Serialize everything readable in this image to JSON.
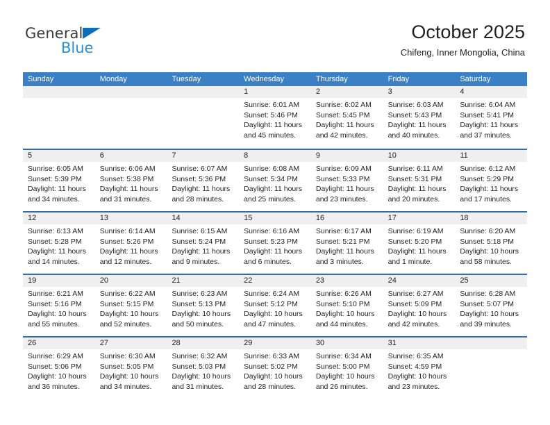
{
  "brand": {
    "name_top": "General",
    "name_bottom": "Blue",
    "triangle_color": "#0e6dbb",
    "blue_color": "#2b8fd8"
  },
  "header": {
    "month_title": "October 2025",
    "location": "Chifeng, Inner Mongolia, China"
  },
  "theme": {
    "header_bg": "#3b7fc4",
    "row_divider": "#2e6da8",
    "day_band_bg": "#efefef"
  },
  "calendar": {
    "weekdays": [
      "Sunday",
      "Monday",
      "Tuesday",
      "Wednesday",
      "Thursday",
      "Friday",
      "Saturday"
    ],
    "weeks": [
      [
        {
          "day": "",
          "lines": []
        },
        {
          "day": "",
          "lines": []
        },
        {
          "day": "",
          "lines": []
        },
        {
          "day": "1",
          "lines": [
            "Sunrise: 6:01 AM",
            "Sunset: 5:46 PM",
            "Daylight: 11 hours",
            "and 45 minutes."
          ]
        },
        {
          "day": "2",
          "lines": [
            "Sunrise: 6:02 AM",
            "Sunset: 5:45 PM",
            "Daylight: 11 hours",
            "and 42 minutes."
          ]
        },
        {
          "day": "3",
          "lines": [
            "Sunrise: 6:03 AM",
            "Sunset: 5:43 PM",
            "Daylight: 11 hours",
            "and 40 minutes."
          ]
        },
        {
          "day": "4",
          "lines": [
            "Sunrise: 6:04 AM",
            "Sunset: 5:41 PM",
            "Daylight: 11 hours",
            "and 37 minutes."
          ]
        }
      ],
      [
        {
          "day": "5",
          "lines": [
            "Sunrise: 6:05 AM",
            "Sunset: 5:39 PM",
            "Daylight: 11 hours",
            "and 34 minutes."
          ]
        },
        {
          "day": "6",
          "lines": [
            "Sunrise: 6:06 AM",
            "Sunset: 5:38 PM",
            "Daylight: 11 hours",
            "and 31 minutes."
          ]
        },
        {
          "day": "7",
          "lines": [
            "Sunrise: 6:07 AM",
            "Sunset: 5:36 PM",
            "Daylight: 11 hours",
            "and 28 minutes."
          ]
        },
        {
          "day": "8",
          "lines": [
            "Sunrise: 6:08 AM",
            "Sunset: 5:34 PM",
            "Daylight: 11 hours",
            "and 25 minutes."
          ]
        },
        {
          "day": "9",
          "lines": [
            "Sunrise: 6:09 AM",
            "Sunset: 5:33 PM",
            "Daylight: 11 hours",
            "and 23 minutes."
          ]
        },
        {
          "day": "10",
          "lines": [
            "Sunrise: 6:11 AM",
            "Sunset: 5:31 PM",
            "Daylight: 11 hours",
            "and 20 minutes."
          ]
        },
        {
          "day": "11",
          "lines": [
            "Sunrise: 6:12 AM",
            "Sunset: 5:29 PM",
            "Daylight: 11 hours",
            "and 17 minutes."
          ]
        }
      ],
      [
        {
          "day": "12",
          "lines": [
            "Sunrise: 6:13 AM",
            "Sunset: 5:28 PM",
            "Daylight: 11 hours",
            "and 14 minutes."
          ]
        },
        {
          "day": "13",
          "lines": [
            "Sunrise: 6:14 AM",
            "Sunset: 5:26 PM",
            "Daylight: 11 hours",
            "and 12 minutes."
          ]
        },
        {
          "day": "14",
          "lines": [
            "Sunrise: 6:15 AM",
            "Sunset: 5:24 PM",
            "Daylight: 11 hours",
            "and 9 minutes."
          ]
        },
        {
          "day": "15",
          "lines": [
            "Sunrise: 6:16 AM",
            "Sunset: 5:23 PM",
            "Daylight: 11 hours",
            "and 6 minutes."
          ]
        },
        {
          "day": "16",
          "lines": [
            "Sunrise: 6:17 AM",
            "Sunset: 5:21 PM",
            "Daylight: 11 hours",
            "and 3 minutes."
          ]
        },
        {
          "day": "17",
          "lines": [
            "Sunrise: 6:19 AM",
            "Sunset: 5:20 PM",
            "Daylight: 11 hours",
            "and 1 minute."
          ]
        },
        {
          "day": "18",
          "lines": [
            "Sunrise: 6:20 AM",
            "Sunset: 5:18 PM",
            "Daylight: 10 hours",
            "and 58 minutes."
          ]
        }
      ],
      [
        {
          "day": "19",
          "lines": [
            "Sunrise: 6:21 AM",
            "Sunset: 5:16 PM",
            "Daylight: 10 hours",
            "and 55 minutes."
          ]
        },
        {
          "day": "20",
          "lines": [
            "Sunrise: 6:22 AM",
            "Sunset: 5:15 PM",
            "Daylight: 10 hours",
            "and 52 minutes."
          ]
        },
        {
          "day": "21",
          "lines": [
            "Sunrise: 6:23 AM",
            "Sunset: 5:13 PM",
            "Daylight: 10 hours",
            "and 50 minutes."
          ]
        },
        {
          "day": "22",
          "lines": [
            "Sunrise: 6:24 AM",
            "Sunset: 5:12 PM",
            "Daylight: 10 hours",
            "and 47 minutes."
          ]
        },
        {
          "day": "23",
          "lines": [
            "Sunrise: 6:26 AM",
            "Sunset: 5:10 PM",
            "Daylight: 10 hours",
            "and 44 minutes."
          ]
        },
        {
          "day": "24",
          "lines": [
            "Sunrise: 6:27 AM",
            "Sunset: 5:09 PM",
            "Daylight: 10 hours",
            "and 42 minutes."
          ]
        },
        {
          "day": "25",
          "lines": [
            "Sunrise: 6:28 AM",
            "Sunset: 5:07 PM",
            "Daylight: 10 hours",
            "and 39 minutes."
          ]
        }
      ],
      [
        {
          "day": "26",
          "lines": [
            "Sunrise: 6:29 AM",
            "Sunset: 5:06 PM",
            "Daylight: 10 hours",
            "and 36 minutes."
          ]
        },
        {
          "day": "27",
          "lines": [
            "Sunrise: 6:30 AM",
            "Sunset: 5:05 PM",
            "Daylight: 10 hours",
            "and 34 minutes."
          ]
        },
        {
          "day": "28",
          "lines": [
            "Sunrise: 6:32 AM",
            "Sunset: 5:03 PM",
            "Daylight: 10 hours",
            "and 31 minutes."
          ]
        },
        {
          "day": "29",
          "lines": [
            "Sunrise: 6:33 AM",
            "Sunset: 5:02 PM",
            "Daylight: 10 hours",
            "and 28 minutes."
          ]
        },
        {
          "day": "30",
          "lines": [
            "Sunrise: 6:34 AM",
            "Sunset: 5:00 PM",
            "Daylight: 10 hours",
            "and 26 minutes."
          ]
        },
        {
          "day": "31",
          "lines": [
            "Sunrise: 6:35 AM",
            "Sunset: 4:59 PM",
            "Daylight: 10 hours",
            "and 23 minutes."
          ]
        },
        {
          "day": "",
          "lines": []
        }
      ]
    ]
  }
}
